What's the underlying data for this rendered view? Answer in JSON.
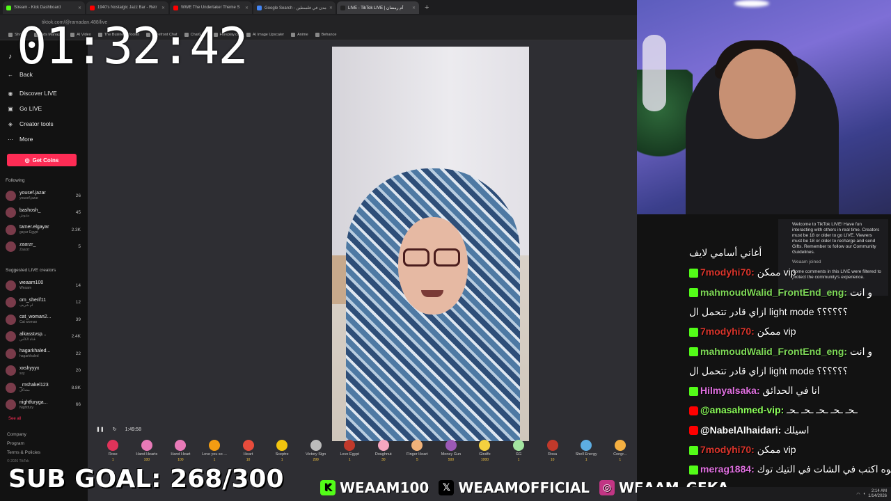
{
  "browser": {
    "tabs": [
      {
        "label": "Stream - Kick Dashboard",
        "color": "#53fc18"
      },
      {
        "label": "1940's Nostalgic Jazz Bar - Retr",
        "color": "#ff0000"
      },
      {
        "label": "WWE The Undertaker Theme S",
        "color": "#ff0000"
      },
      {
        "label": "Google Search - مدن في فلسطين",
        "color": "#4285f4"
      },
      {
        "label": "LIVE - TikTok LIVE | أم رمضان",
        "color": "#222222"
      }
    ],
    "url": "tiktok.com/@ramadan.488/live",
    "bookmarks": [
      "Shopify",
      "Ads Manager",
      "AI Video",
      "The Business Toolkit",
      "Forefront Chat",
      "ChatGPT",
      "Foreplay.co",
      "AI Image Upscaler",
      "Anime",
      "Behance"
    ]
  },
  "sidebar": {
    "nav": [
      {
        "label": "Back",
        "icon": "back-arrow-icon"
      },
      {
        "label": "Discover LIVE",
        "icon": "live-icon"
      },
      {
        "label": "Go LIVE",
        "icon": "camera-icon"
      },
      {
        "label": "Creator tools",
        "icon": "tools-icon"
      },
      {
        "label": "More",
        "icon": "more-icon"
      }
    ],
    "get_coins": "Get Coins",
    "following_label": "Following",
    "following": [
      {
        "name": "yousef.jazar",
        "sub": "yousef.jazar",
        "count": "26"
      },
      {
        "name": "bashosh_",
        "sub": "بشوش",
        "count": "45"
      },
      {
        "name": "tamer.elgayar",
        "sub": "gayar Egypt",
        "count": "2.3K"
      },
      {
        "name": "zaarzr_",
        "sub": "Zaarzr",
        "count": "5"
      }
    ],
    "suggested_label": "Suggested LIVE creators",
    "suggested": [
      {
        "name": "weaam100",
        "sub": "Weaam",
        "count": "14"
      },
      {
        "name": "om_sherif11",
        "sub": "ام شريف",
        "count": "12"
      },
      {
        "name": "cat_woman2...",
        "sub": "Cat woman",
        "count": "39"
      },
      {
        "name": "alkasstvsp...",
        "sub": "قناة الكأس",
        "count": "2.4K"
      },
      {
        "name": "hagarkhaled...",
        "sub": "hagarkhaled",
        "count": "22"
      },
      {
        "name": "xxshyyyx",
        "sub": "sxy",
        "count": "20"
      },
      {
        "name": "_mshakel123",
        "sub": "مشاكل",
        "count": "8.8K"
      },
      {
        "name": "nightfurygа...",
        "sub": "Nightfury",
        "count": "66"
      }
    ],
    "see_all": "See all",
    "footer": [
      "Company",
      "Program",
      "Terms & Policies",
      "© 2026 TikTok"
    ]
  },
  "stream": {
    "elapsed": "1:49:58",
    "gifts": [
      {
        "name": "Rose",
        "price": "1",
        "color": "#e0335a"
      },
      {
        "name": "Hand Hearts",
        "price": "100",
        "color": "#e87ab8"
      },
      {
        "name": "Hand Heart",
        "price": "100",
        "color": "#e87ab8"
      },
      {
        "name": "Love you so ...",
        "price": "1",
        "color": "#f39c12"
      },
      {
        "name": "Heart",
        "price": "10",
        "color": "#e74c3c"
      },
      {
        "name": "Sceptre",
        "price": "1",
        "color": "#f1c40f"
      },
      {
        "name": "Victory Sign",
        "price": "299",
        "color": "#bbbbbb"
      },
      {
        "name": "Love Egypt",
        "price": "1",
        "color": "#c0392b"
      },
      {
        "name": "Doughnut",
        "price": "30",
        "color": "#f5a6c0"
      },
      {
        "name": "Finger Heart",
        "price": "5",
        "color": "#f0b27a"
      },
      {
        "name": "Money Gun",
        "price": "500",
        "color": "#9b59b6"
      },
      {
        "name": "Giraffe",
        "price": "1000",
        "color": "#f4d03f"
      },
      {
        "name": "GG",
        "price": "1",
        "color": "#a3e4a0"
      },
      {
        "name": "Rosa",
        "price": "10",
        "color": "#c0392b"
      },
      {
        "name": "Shell Energy",
        "price": "1",
        "color": "#5dade2"
      },
      {
        "name": "Congr...",
        "price": "1",
        "color": "#f5b041"
      }
    ]
  },
  "overlay": {
    "timer": "01:32:42",
    "sub_goal": "SUB GOAL: 268/300",
    "socials": [
      {
        "handle": "WEAAM100",
        "icon": "kick-icon",
        "color": "#53fc18"
      },
      {
        "handle": "WEAAMOFFICIAL",
        "icon": "x-icon",
        "color": "#000000"
      },
      {
        "handle": "WEAAM_GEKA",
        "icon": "instagram-icon",
        "color": "#c13584"
      }
    ]
  },
  "tiktok_panel": {
    "welcome": "Welcome to TikTok LIVE! Have fun interacting with others in real time. Creators must be 18 or older to go LIVE. Viewers must be 18 or older to recharge and send Gifts. Remember to follow our Community Guidelines.",
    "joined": "Weaam joined",
    "filtered": "Some comments in this LIVE were filtered to protect the community's experience."
  },
  "chat": [
    {
      "platform": "",
      "user": "",
      "text": "أغاني أسامي لايف"
    },
    {
      "platform": "kick",
      "user": "7modyhi70:",
      "color": "red",
      "text": "ممكن vip"
    },
    {
      "platform": "kick",
      "user": "mahmoudWalid_FrontEnd_eng:",
      "color": "green",
      "text": "و انت"
    },
    {
      "platform": "",
      "user": "",
      "text": "ازاي قادر تتحمل ال light mode ؟؟؟؟؟؟"
    },
    {
      "platform": "kick",
      "user": "7modyhi70:",
      "color": "red",
      "text": "ممكن vip"
    },
    {
      "platform": "kick",
      "user": "mahmoudWalid_FrontEnd_eng:",
      "color": "green",
      "text": "و انت"
    },
    {
      "platform": "",
      "user": "",
      "text": "ازاي قادر تتحمل ال light mode ؟؟؟؟؟؟"
    },
    {
      "platform": "kick",
      "user": "Hilmyalsaka:",
      "color": "pink",
      "text": "انا في الحدائق"
    },
    {
      "platform": "youtube",
      "user": "@anasahmed-vip:",
      "color": "lime",
      "text": "ـحـ ـحـ ـحـ ـحـ ـحـ"
    },
    {
      "platform": "youtube",
      "user": "@NabelAlhaidari:",
      "color": "white",
      "text": "اسيلك"
    },
    {
      "platform": "kick",
      "user": "7modyhi70:",
      "color": "red",
      "text": "ممكن vip"
    },
    {
      "platform": "kick",
      "user": "merag1884:",
      "color": "pink",
      "text": "ايوه اكتب في الشات في التيك توك"
    }
  ],
  "taskbar": {
    "time": "2:14 AM",
    "date": "1/14/2026"
  }
}
